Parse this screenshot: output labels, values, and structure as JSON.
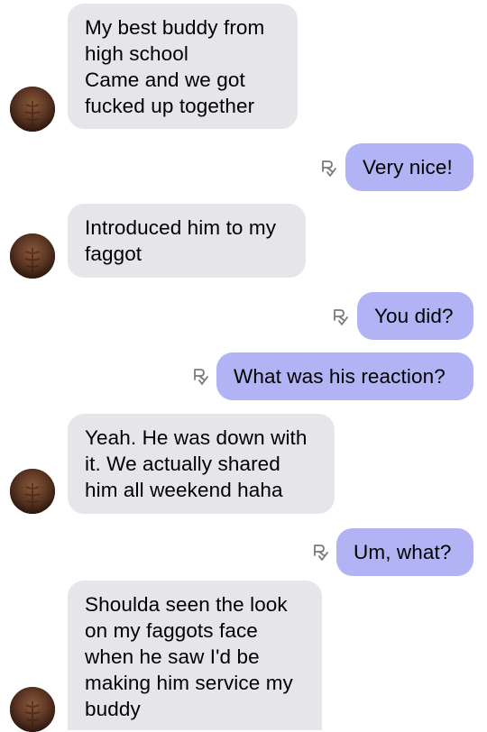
{
  "conversation": {
    "messages": [
      {
        "direction": "incoming",
        "text": "My best buddy from\nhigh school\nCame and we got\nfucked up together"
      },
      {
        "direction": "outgoing",
        "text": "Very nice!"
      },
      {
        "direction": "incoming",
        "text": "Introduced him to my\nfaggot"
      },
      {
        "direction": "outgoing",
        "text": "You did?"
      },
      {
        "direction": "outgoing",
        "text": "What was his reaction?"
      },
      {
        "direction": "incoming",
        "text": "Yeah. He was down with\nit. We actually shared\nhim all weekend haha"
      },
      {
        "direction": "outgoing",
        "text": "Um, what?"
      },
      {
        "direction": "incoming",
        "text": "Shoulda seen the look\non my faggots face\nwhen he saw I'd be\nmaking him service my\nbuddy"
      }
    ]
  },
  "colors": {
    "incoming_bubble": "#e5e5ea",
    "outgoing_bubble": "#b1b3f5",
    "text": "#000000",
    "receipt_icon": "#7a7a7a"
  },
  "icons": {
    "avatar": "contact-avatar-photo",
    "receipt": "read-receipt-icon"
  }
}
